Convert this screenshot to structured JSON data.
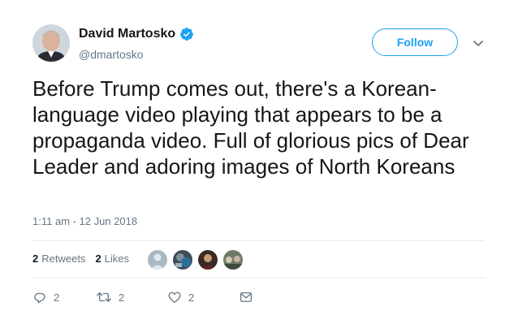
{
  "author": {
    "name": "David Martosko",
    "handle": "@dmartosko",
    "verified": true
  },
  "follow_label": "Follow",
  "tweet": {
    "text": "Before Trump comes out, there's a Korean-language video playing that appears to be a propaganda video. Full of glorious pics of Dear Leader and adoring images of North Koreans",
    "timestamp": "1:11 am - 12 Jun 2018"
  },
  "stats": {
    "retweets_count": "2",
    "retweets_label": "Retweets",
    "likes_count": "2",
    "likes_label": "Likes"
  },
  "actions": {
    "reply_count": "2",
    "retweet_count": "2",
    "like_count": "2"
  },
  "colors": {
    "accent": "#1da1f2",
    "text": "#14171a",
    "muted": "#657786",
    "divider": "#e6ecf0"
  }
}
